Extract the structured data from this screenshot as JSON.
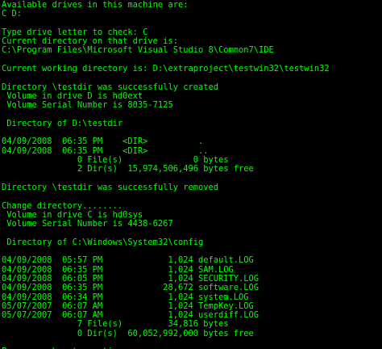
{
  "console": {
    "text_color": "#00ff00",
    "background_color": "#000000",
    "lines": [
      "Available drives in this machine are:",
      "C D:",
      "",
      "Type drive letter to check: C",
      "Current directory on that drive is:",
      "C:\\Program Files\\Microsoft Visual Studio 8\\Common7\\IDE",
      "",
      "Current working directory is: D:\\extraproject\\testwin32\\testwin32",
      "",
      "Directory \\testdir was successfully created",
      " Volume in drive D is hd0ext",
      " Volume Serial Number is 8035-7125",
      "",
      " Directory of D:\\testdir",
      "",
      "04/09/2008  06:35 PM    <DIR>          .",
      "04/09/2008  06:35 PM    <DIR>          ..",
      "               0 File(s)              0 bytes",
      "               2 Dir(s)  15,974,506,496 bytes free",
      "",
      "Directory \\testdir was successfully removed",
      "",
      "Change directory........",
      " Volume in drive C is hd0sys",
      " Volume Serial Number is 4438-6267",
      "",
      " Directory of C:\\Windows\\System32\\config",
      "",
      "04/09/2008  05:57 PM             1,024 default.LOG",
      "04/09/2008  06:35 PM             1,024 SAM.LOG",
      "04/09/2008  06:05 PM             1,024 SECURITY.LOG",
      "04/09/2008  06:35 PM            28,672 software.LOG",
      "04/09/2008  06:34 PM             1,024 system.LOG",
      "05/07/2007  06:07 AM             1,024 TempKey.LOG",
      "05/07/2007  06:07 AM             1,024 userdiff.LOG",
      "               7 File(s)         34,816 bytes",
      "               0 Dir(s)  60,052,992,000 bytes free",
      "",
      "Press any key to continue . . ."
    ]
  }
}
